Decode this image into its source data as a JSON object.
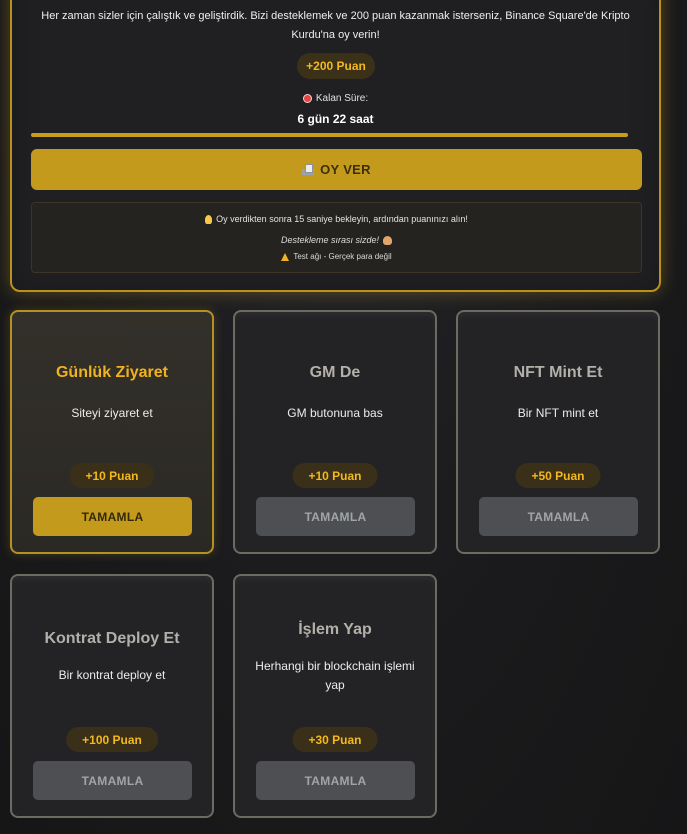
{
  "vote": {
    "description": "Her zaman sizler için çalıştık ve geliştirdik. Bizi desteklemek ve 200 puan kazanmak isterseniz, Binance Square'de Kripto Kurdu'na oy verin!",
    "bonus": "+200 Puan",
    "timer_label": "Kalan Süre:",
    "timer_value": "6 gün 22 saat",
    "progress_fraction": 1.0,
    "button_label": "OY VER",
    "info_wait": "Oy verdikten sonra 15 saniye bekleyin, ardından puanınızı alın!",
    "info_support": "Destekleme sırası sizde!",
    "info_warning": "Test ağı - Gerçek para değil"
  },
  "tasks": [
    {
      "title": "Günlük Ziyaret",
      "desc": "Siteyi ziyaret et",
      "points": "+10 Puan",
      "button": "TAMAMLA",
      "active": true
    },
    {
      "title": "GM De",
      "desc": "GM butonuna bas",
      "points": "+10 Puan",
      "button": "TAMAMLA",
      "active": false
    },
    {
      "title": "NFT Mint Et",
      "desc": "Bir NFT mint et",
      "points": "+50 Puan",
      "button": "TAMAMLA",
      "active": false
    },
    {
      "title": "Kontrat Deploy Et",
      "desc": "Bir kontrat deploy et",
      "points": "+100 Puan",
      "button": "TAMAMLA",
      "active": false
    },
    {
      "title": "İşlem Yap",
      "desc": "Herhangi bir blockchain işlemi yap",
      "points": "+30 Puan",
      "button": "TAMAMLA",
      "active": false
    }
  ],
  "colors": {
    "accent": "#c39a1b",
    "accent_text": "#f2b81e",
    "disabled_button": "#4d4f52"
  }
}
